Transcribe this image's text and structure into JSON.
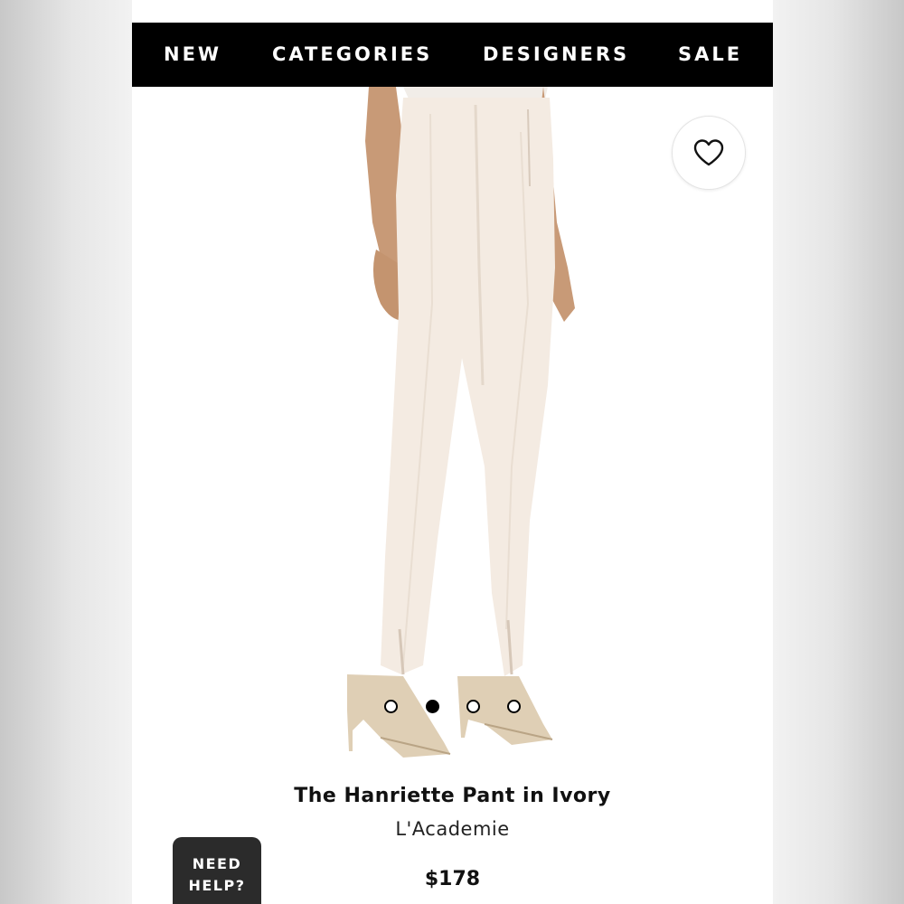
{
  "nav": {
    "items": [
      {
        "label": "NEW"
      },
      {
        "label": "CATEGORIES"
      },
      {
        "label": "DESIGNERS"
      },
      {
        "label": "SALE"
      }
    ]
  },
  "product": {
    "title": "The Hanriette Pant in Ivory",
    "designer": "L'Academie",
    "price": "$178",
    "color": "#f4ebe2"
  },
  "gallery": {
    "image_count": 4,
    "active_index": 1
  },
  "favorite": {
    "icon": "heart-icon"
  },
  "help": {
    "line1": "NEED",
    "line2": "HELP?"
  }
}
